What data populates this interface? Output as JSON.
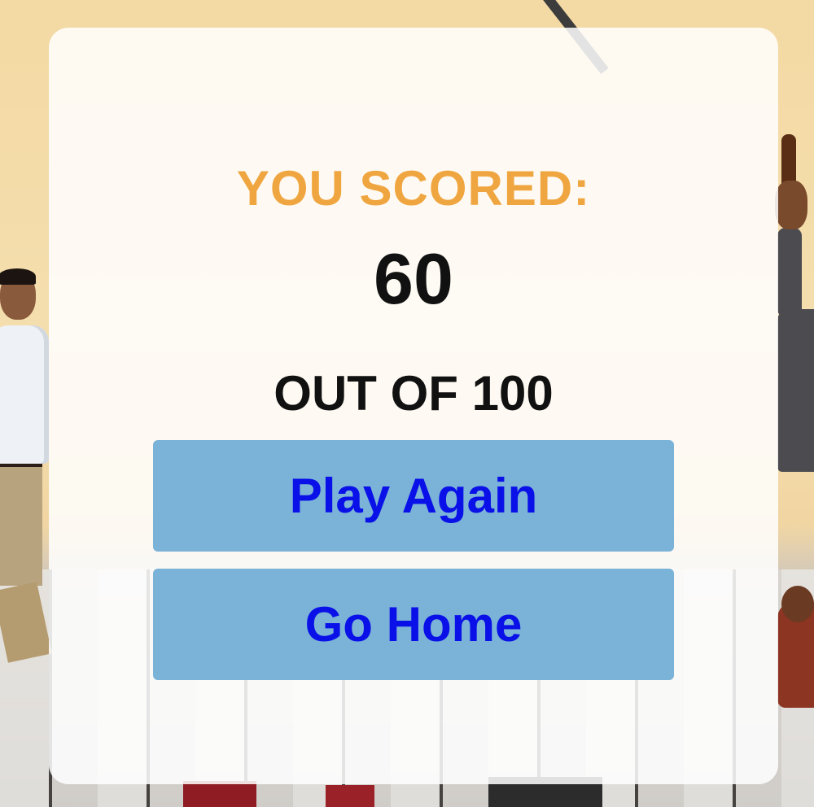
{
  "result": {
    "heading": "YOU SCORED:",
    "score": "60",
    "out_of": "OUT OF 100"
  },
  "actions": {
    "play_again_label": "Play Again",
    "go_home_label": "Go Home"
  },
  "colors": {
    "heading": "#f0a640",
    "score_text": "#111111",
    "button_bg": "#7ab2d8",
    "button_text": "#0a10e8",
    "card_bg": "rgba(255,255,255,0.86)"
  }
}
